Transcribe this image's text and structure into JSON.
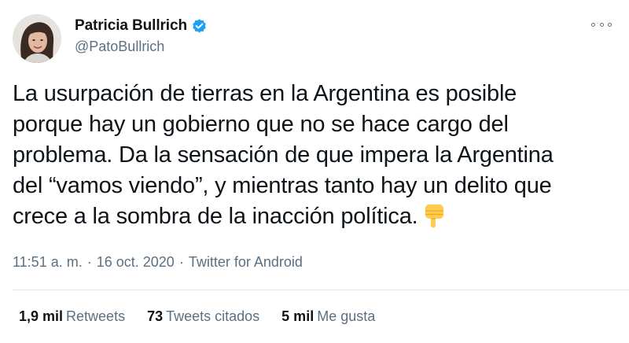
{
  "author": {
    "display_name": "Patricia Bullrich",
    "handle": "@PatoBullrich",
    "verified": true
  },
  "tweet": {
    "lines": [
      "La usurpación de tierras en la Argentina es posible",
      "porque hay un gobierno que no se hace cargo del",
      "problema. Da la sensación de que impera la Argentina",
      "del “vamos viendo”, y mientras tanto hay un delito que",
      "crece a la sombra de la inacción política."
    ],
    "emoji": "backhand-index-pointing-down"
  },
  "meta": {
    "time": "11:51 a. m.",
    "separator": "·",
    "date": "16 oct. 2020",
    "source": "Twitter for Android"
  },
  "stats": {
    "retweets": {
      "count": "1,9 mil",
      "label": "Retweets"
    },
    "quotes": {
      "count": "73",
      "label": "Tweets citados"
    },
    "likes": {
      "count": "5 mil",
      "label": "Me gusta"
    }
  },
  "colors": {
    "text": "#0f1419",
    "secondary": "#5b7083",
    "verified": "#1da1f2",
    "divider": "#e1e8ed"
  }
}
